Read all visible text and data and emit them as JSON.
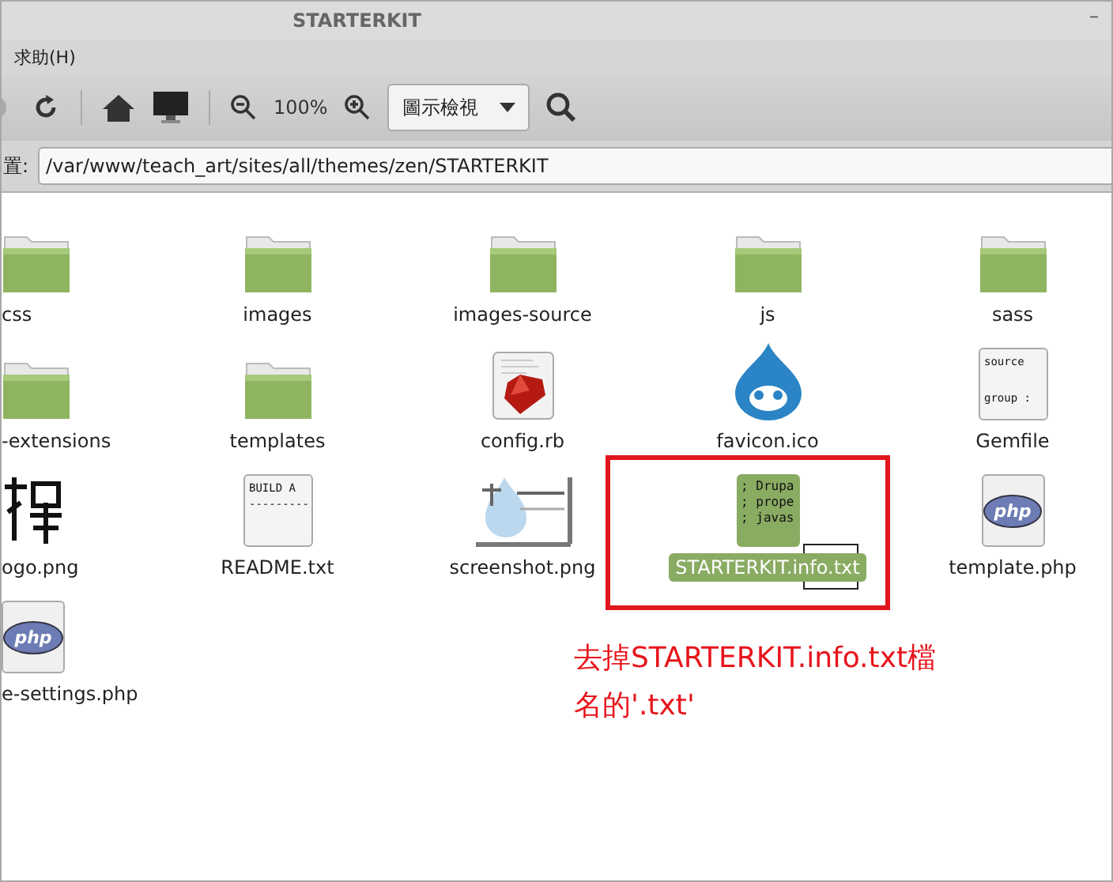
{
  "window": {
    "title": "STARTERKIT",
    "minimize": "–"
  },
  "menu": [
    "求助(H)"
  ],
  "toolbar": {
    "zoom": "100%",
    "view_mode": "圖示檢視"
  },
  "location": {
    "label": "置:",
    "path": "/var/www/teach_art/sites/all/themes/zen/STARTERKIT"
  },
  "rows": [
    [
      {
        "name": "css",
        "kind": "folder",
        "selected": false
      },
      {
        "name": "images",
        "kind": "folder",
        "selected": false
      },
      {
        "name": "images-source",
        "kind": "folder",
        "selected": false
      },
      {
        "name": "js",
        "kind": "folder",
        "selected": false
      },
      {
        "name": "sass",
        "kind": "folder",
        "selected": false
      }
    ],
    [
      {
        "name": "-extensions",
        "kind": "folder",
        "selected": false
      },
      {
        "name": "templates",
        "kind": "folder",
        "selected": false
      },
      {
        "name": "config.rb",
        "kind": "ruby",
        "selected": false
      },
      {
        "name": "favicon.ico",
        "kind": "drupal",
        "selected": false
      },
      {
        "name": "Gemfile",
        "kind": "text",
        "preview": [
          "source",
          "group :"
        ],
        "selected": false
      }
    ],
    [
      {
        "name": "ogo.png",
        "kind": "picture",
        "selected": false
      },
      {
        "name": "README.txt",
        "kind": "text",
        "preview": [
          "BUILD A",
          "---------"
        ],
        "selected": false
      },
      {
        "name": "screenshot.png",
        "kind": "picture",
        "selected": false
      },
      {
        "name": "STARTERKIT.info.txt",
        "kind": "info",
        "preview": [
          "; Drupa",
          "; prope",
          "; javas"
        ],
        "selected": true,
        "annotated": true
      },
      {
        "name": "template.php",
        "kind": "php",
        "badge": "php",
        "selected": false
      }
    ],
    [
      {
        "name": "e-settings.php",
        "kind": "php",
        "badge": "php",
        "selected": false
      }
    ]
  ],
  "annotation": {
    "lines": [
      "去掉STARTERKIT.info.txt檔",
      "名的'.txt'"
    ]
  }
}
